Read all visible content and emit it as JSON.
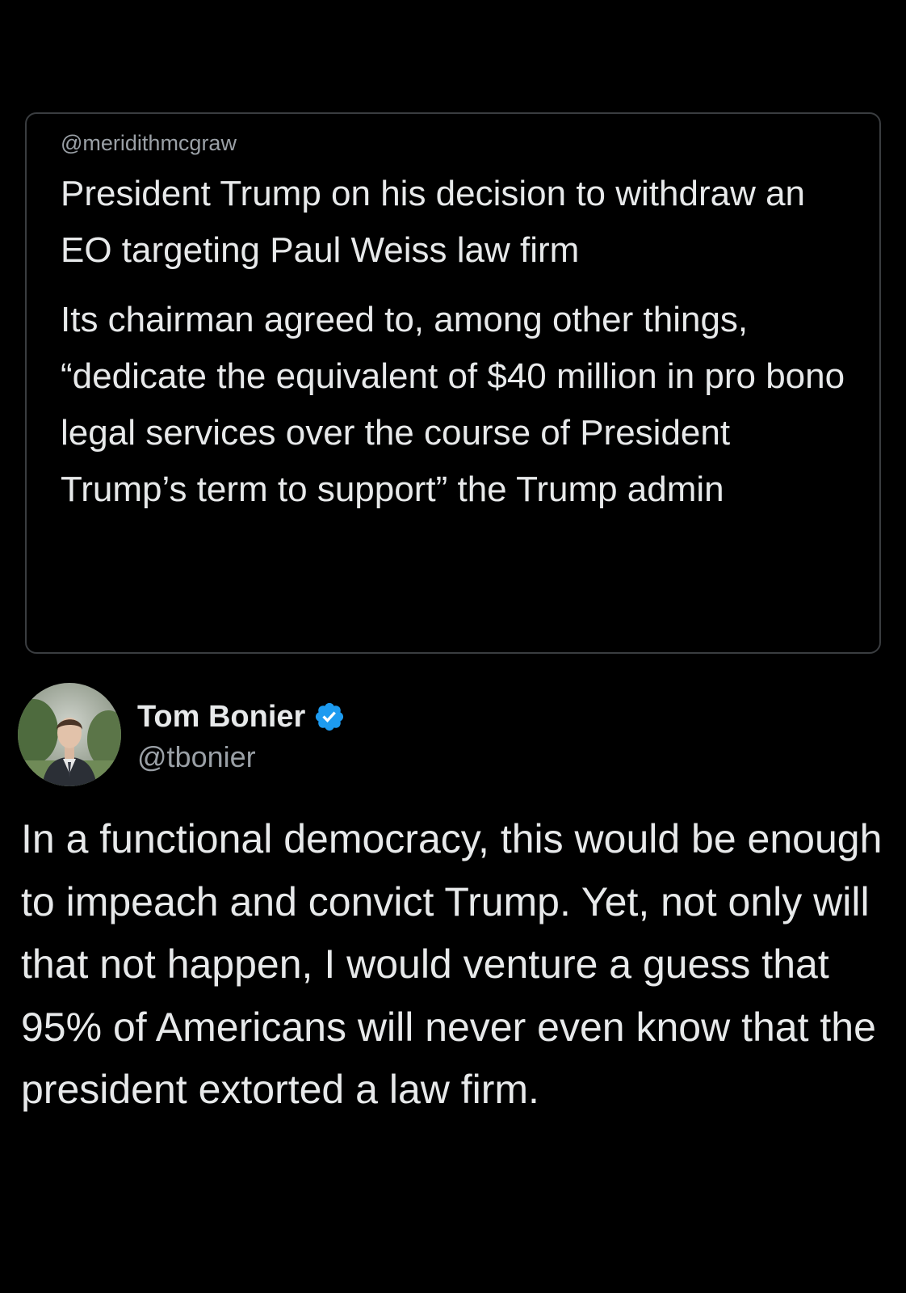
{
  "quoted_post": {
    "handle": "@meridithmcgraw",
    "paragraphs": [
      "President Trump on his decision to withdraw an EO targeting Paul Weiss law firm",
      "Its chairman agreed to, among other things, “dedicate the equivalent of $40 million in pro bono legal services over the course of President Trump’s term to support” the Trump admin"
    ]
  },
  "post": {
    "author_name": "Tom Bonier",
    "author_handle": "@tbonier",
    "verified_icon": "verified-badge-icon",
    "body": "In a functional democracy, this would be enough to impeach and convict Trump. Yet, not only will that not happen, I would venture a guess that 95% of Americans will never even know that the president extorted a law firm."
  },
  "colors": {
    "background": "#000000",
    "text": "#e7e9ea",
    "secondary_text": "#9aa0a6",
    "card_border": "#3a3d40",
    "verified": "#1d9bf0"
  }
}
